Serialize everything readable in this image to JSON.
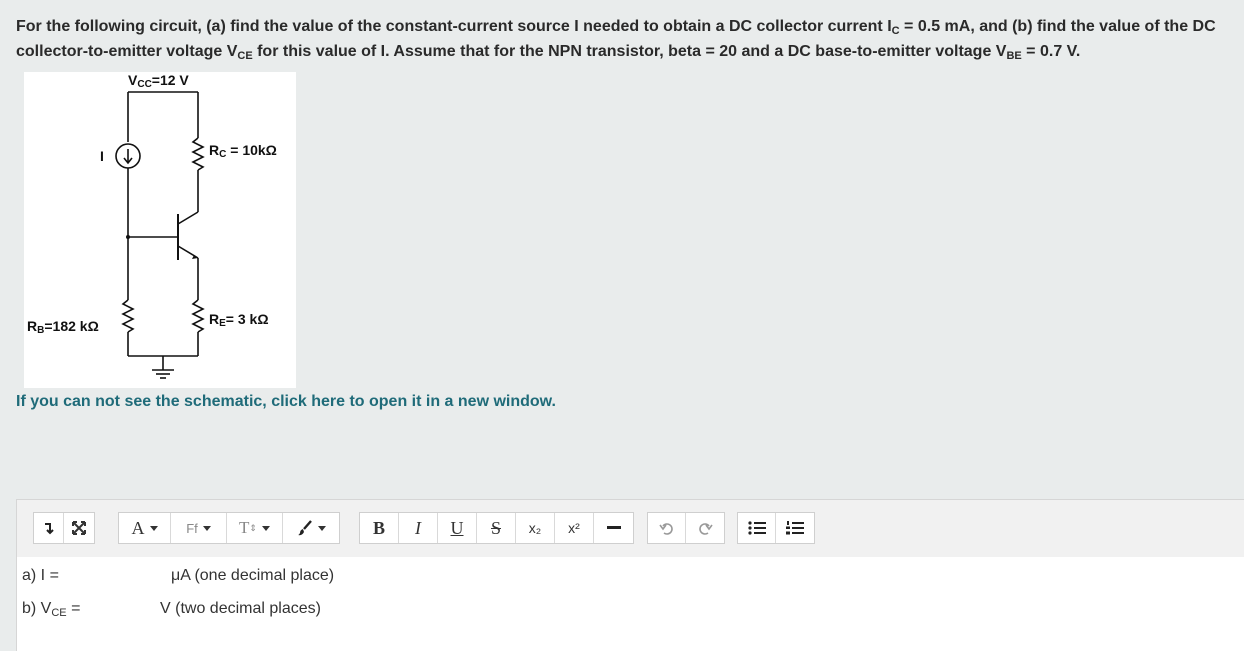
{
  "question": {
    "part1": "For the following circuit, (a) find the value of the constant-current source  I needed to obtain a DC collector current I",
    "ic_sub": "C",
    "part2": " = 0.5 mA, and (b) find the value of the DC collector-to-emitter voltage V",
    "vce_sub": "CE",
    "part3": " for this value of I. Assume that for the NPN transistor, beta = 20 and a DC base-to-emitter voltage V",
    "vbe_sub": "BE",
    "part4": " = 0.7 V."
  },
  "schematic": {
    "vcc_main": "V",
    "vcc_sub": "CC",
    "vcc_value": "=12 V",
    "source_label": "I",
    "rc_main": "R",
    "rc_sub": "C",
    "rc_value": " = 10kΩ",
    "rb_main": "R",
    "rb_sub": "B",
    "rb_value": "=182 kΩ",
    "re_main": "R",
    "re_sub": "E",
    "re_value": "= 3 kΩ"
  },
  "link_text": "If you can not see the schematic, click here to open it in a new window.",
  "toolbar": {
    "font_color_label": "A",
    "font_family_label": "Ff",
    "font_size_label": "T",
    "bold_label": "B",
    "italic_label": "I",
    "underline_label": "U",
    "strike_label": "S",
    "subscript_label": "x₂",
    "superscript_label": "x²"
  },
  "answers": {
    "a_label": "a) I =",
    "a_unit": "μA (one decimal place)",
    "b_label_main": "b) V",
    "b_label_sub": "CE",
    "b_label_end": " =",
    "b_unit": "V (two decimal places)"
  }
}
